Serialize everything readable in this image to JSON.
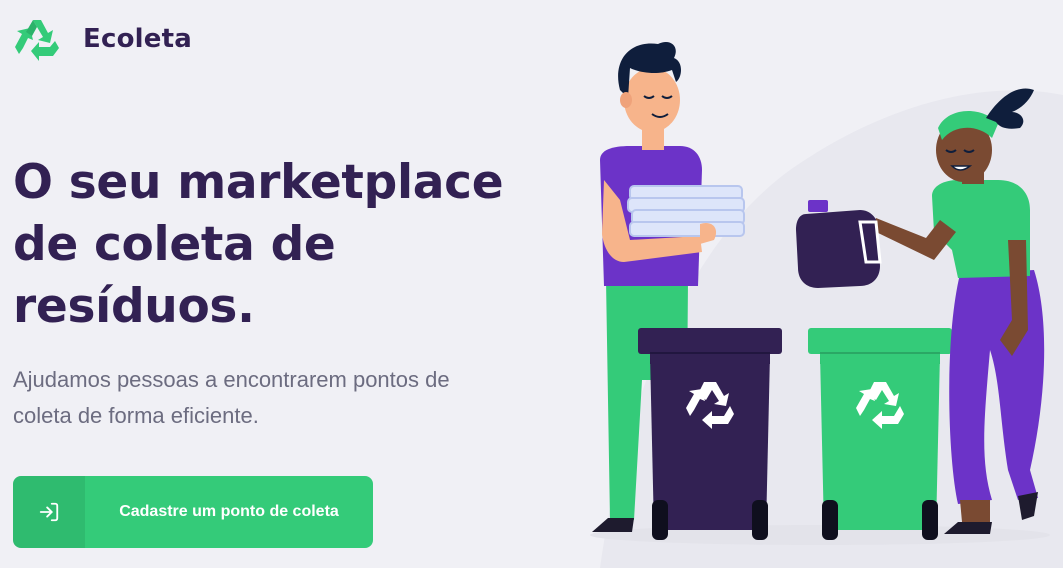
{
  "header": {
    "logo_icon": "recycle-icon",
    "brand_name": "Ecoleta"
  },
  "hero": {
    "title": "O seu marketplace de coleta de resíduos.",
    "subtitle": "Ajudamos pessoas a encontrarem pontos de coleta de forma eficiente."
  },
  "cta": {
    "icon": "log-in-icon",
    "label": "Cadastre um ponto de coleta"
  },
  "colors": {
    "background": "#F0F0F5",
    "brand_dark": "#322153",
    "accent_green": "#34CB79",
    "text_muted": "#6C6C80",
    "purple": "#6C33C8"
  }
}
